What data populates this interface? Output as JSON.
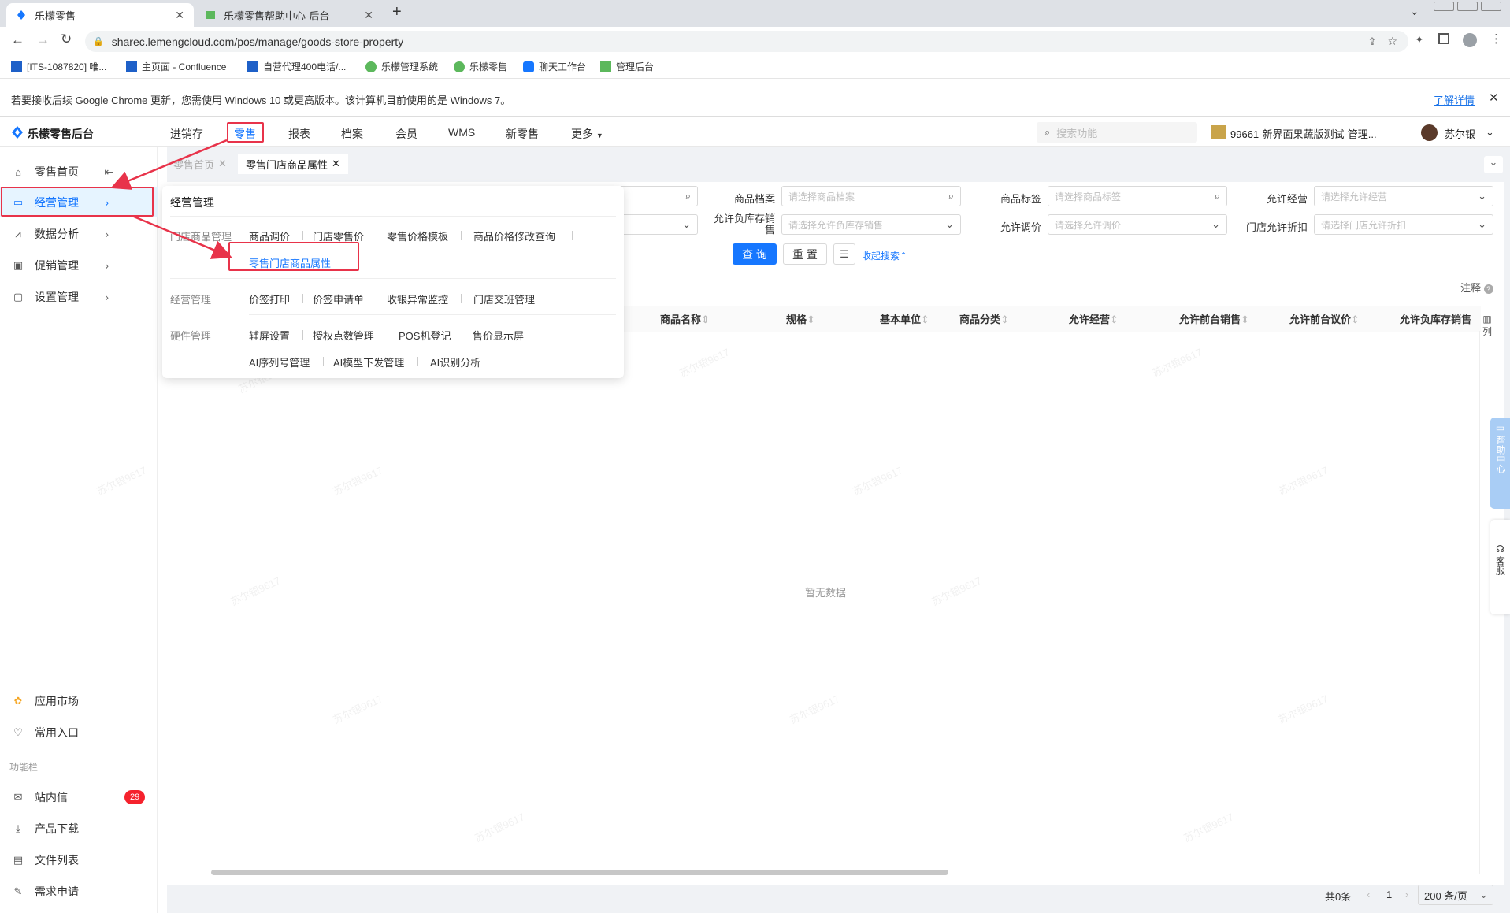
{
  "browser": {
    "tabs": [
      {
        "title": "乐檬零售",
        "close": "✕"
      },
      {
        "title": "乐檬零售帮助中心-后台",
        "close": "✕"
      }
    ],
    "new_tab": "+",
    "url": "sharec.lemengcloud.com/pos/manage/goods-store-property",
    "bookmarks": [
      "[ITS-1087820] 唯...",
      "主页面 - Confluence",
      "自营代理400电话/...",
      "乐檬管理系统",
      "乐檬零售",
      "聊天工作台",
      "管理后台"
    ],
    "infobar": {
      "message": "若要接收后续 Google Chrome 更新，您需使用 Windows 10 或更高版本。该计算机目前使用的是 Windows 7。",
      "link": "了解详情",
      "close": "✕"
    }
  },
  "app": {
    "logo": "乐檬零售后台",
    "nav": [
      "进销存",
      "零售",
      "报表",
      "档案",
      "会员",
      "WMS",
      "新零售",
      "更多"
    ],
    "search_placeholder": "搜索功能",
    "store": "99661-新界面果蔬版测试-管理...",
    "user": "苏尔银"
  },
  "sidebar": {
    "items": [
      "零售首页",
      "经营管理",
      "数据分析",
      "促销管理",
      "设置管理"
    ],
    "bottom": [
      "应用市场",
      "常用入口"
    ],
    "section": "功能栏",
    "tools": [
      "站内信",
      "产品下载",
      "文件列表",
      "需求申请"
    ],
    "badge": "29"
  },
  "page_tabs": [
    "零售首页",
    "零售门店商品属性"
  ],
  "filters": {
    "labels": [
      "商品档案",
      "商品标签",
      "允许经营",
      "允许负库存销售",
      "允许调价",
      "门店允许折扣"
    ],
    "placeholders": [
      "请选择商品档案",
      "请选择商品标签",
      "请选择允许经营",
      "请选择允许负库存销售",
      "请选择允许调价",
      "请选择门店允许折扣"
    ],
    "query": "查 询",
    "reset": "重 置",
    "collapse": "收起搜索"
  },
  "note": "注释",
  "table": {
    "columns": [
      "商品名称",
      "规格",
      "基本单位",
      "商品分类",
      "允许经营",
      "允许前台销售",
      "允许前台议价",
      "允许负库存销售"
    ],
    "col_setting": "列",
    "empty": "暂无数据"
  },
  "pagination": {
    "total": "共0条",
    "page": "1",
    "page_size": "200 条/页"
  },
  "float": {
    "help": "帮助中心",
    "service": "客服"
  },
  "dropdown": {
    "title": "经营管理",
    "groups": [
      {
        "category": "门店商品管理",
        "items": [
          "商品调价",
          "门店零售价",
          "零售价格模板",
          "商品价格修改查询",
          "零售门店商品属性"
        ]
      },
      {
        "category": "经营管理",
        "items": [
          "价签打印",
          "价签申请单",
          "收银异常监控",
          "门店交班管理"
        ]
      },
      {
        "category": "硬件管理",
        "items": [
          "辅屏设置",
          "授权点数管理",
          "POS机登记",
          "售价显示屏",
          "AI序列号管理",
          "AI模型下发管理",
          "AI识别分析"
        ]
      }
    ]
  },
  "watermark": "苏尔银9617",
  "colors": {
    "primary": "#1677ff",
    "annotation": "#e8334a",
    "badge": "#f5222d"
  }
}
